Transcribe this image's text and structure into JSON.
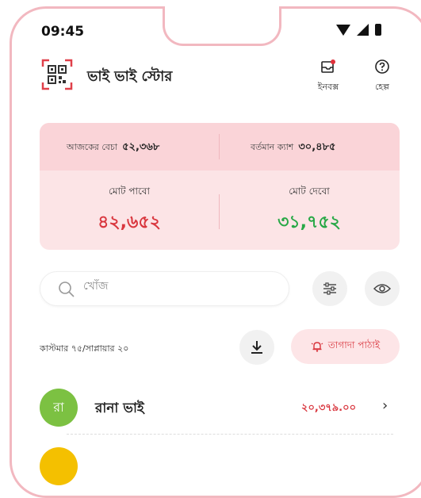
{
  "status_bar": {
    "time": "09:45"
  },
  "header": {
    "store_name": "ভাই ভাই স্টোর",
    "inbox_label": "ইনবক্স",
    "help_label": "হেল্প"
  },
  "summary": {
    "today_sales_label": "আজকের বেচা",
    "today_sales_value": "৫২,৩৬৮",
    "current_cash_label": "বর্তমান ক্যাশ",
    "current_cash_value": "৩০,৪৮৫",
    "total_receivable_label": "মোট পাবো",
    "total_receivable_value": "৪২,৬৫২",
    "total_payable_label": "মোট দেবো",
    "total_payable_value": "৩১,৭৫২"
  },
  "search": {
    "placeholder": "খোঁজ"
  },
  "list_meta": {
    "counts": "কাস্টমার ৭৫/সাপ্লায়ার ২০"
  },
  "tagada": {
    "label": "তাগাদা পাঠাই"
  },
  "customers": [
    {
      "initial": "রা",
      "name": "রানা ভাই",
      "amount": "২০,৩৭৯.০০"
    }
  ],
  "colors": {
    "accent_red": "#d9363e",
    "accent_green": "#27a846",
    "summary_bg": "#fce4e6",
    "avatar_green": "#7cc142",
    "avatar_yellow": "#f4c000"
  },
  "icons": [
    "qr-scan-icon",
    "inbox-icon",
    "help-icon",
    "search-icon",
    "filter-icon",
    "eye-icon",
    "download-icon",
    "bell-icon",
    "chevron-right-icon"
  ]
}
